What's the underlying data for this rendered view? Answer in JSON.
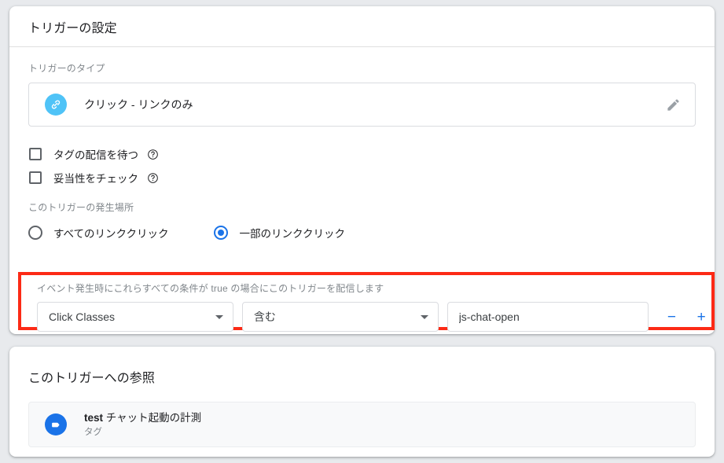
{
  "trigger_card": {
    "title": "トリガーの設定",
    "type_label": "トリガーのタイプ",
    "type_name": "クリック - リンクのみ",
    "type_icon": "link-icon",
    "edit_icon": "pencil-icon",
    "checkboxes": [
      {
        "label": "タグの配信を待つ",
        "checked": false,
        "help_icon": "help-circle-icon"
      },
      {
        "label": "妥当性をチェック",
        "checked": false,
        "help_icon": "help-circle-icon"
      }
    ],
    "radio_group": {
      "label": "このトリガーの発生場所",
      "options": [
        {
          "label": "すべてのリンククリック",
          "selected": false
        },
        {
          "label": "一部のリンククリック",
          "selected": true
        }
      ]
    },
    "condition": {
      "highlight_color": "#fc2a16",
      "label": "イベント発生時にこれらすべての条件が true の場合にこのトリガーを配信します",
      "variable": "Click Classes",
      "operator": "含む",
      "value": "js-chat-open",
      "value_placeholder": "",
      "remove_label": "−",
      "add_label": "+",
      "button_color": "#1a73e8"
    }
  },
  "references_card": {
    "title": "このトリガーへの参照",
    "items": [
      {
        "icon": "tag-icon",
        "name_bold": "test",
        "name_rest": " チャット起動の計測",
        "type": "タグ"
      }
    ]
  }
}
